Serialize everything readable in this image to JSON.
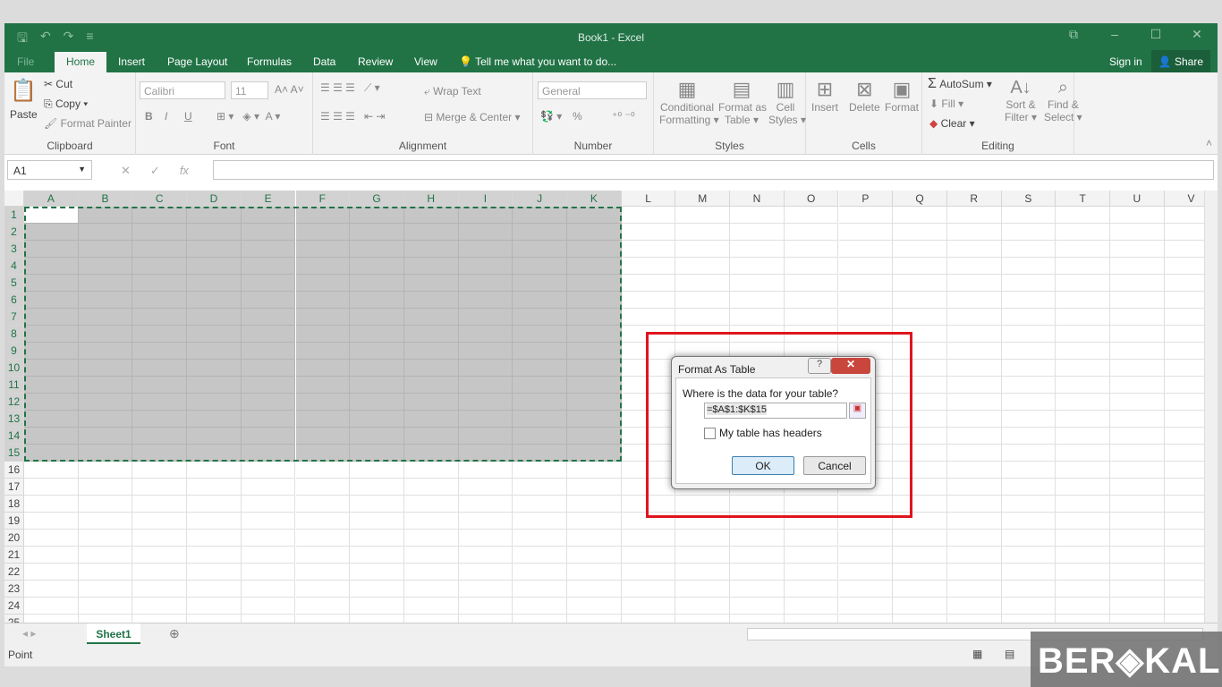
{
  "window": {
    "title": "Book1 - Excel",
    "controls": [
      "⧉",
      "–",
      "☐",
      "✕"
    ]
  },
  "qat": [
    "save-icon",
    "undo-icon",
    "redo-icon",
    "customize-icon"
  ],
  "tabs": [
    {
      "label": "File"
    },
    {
      "label": "Home"
    },
    {
      "label": "Insert"
    },
    {
      "label": "Page Layout"
    },
    {
      "label": "Formulas"
    },
    {
      "label": "Data"
    },
    {
      "label": "Review"
    },
    {
      "label": "View"
    }
  ],
  "tell_me": "Tell me what you want to do...",
  "sign_in": "Sign in",
  "share": "Share",
  "ribbon": {
    "clipboard": {
      "label": "Clipboard",
      "paste": "Paste",
      "cut": "Cut",
      "copy": "Copy",
      "format_painter": "Format Painter"
    },
    "font": {
      "label": "Font",
      "name": "Calibri",
      "size": "11",
      "bold": "B",
      "italic": "I",
      "underline": "U"
    },
    "alignment": {
      "label": "Alignment",
      "wrap": "Wrap Text",
      "merge": "Merge & Center"
    },
    "number": {
      "label": "Number",
      "format": "General",
      "percent": "%"
    },
    "styles": {
      "label": "Styles",
      "conditional": [
        "Conditional",
        "Formatting ▾"
      ],
      "format_table": [
        "Format as",
        "Table ▾"
      ],
      "cell_styles": [
        "Cell",
        "Styles ▾"
      ]
    },
    "cells": {
      "label": "Cells",
      "insert": "Insert",
      "delete": "Delete",
      "format": "Format"
    },
    "editing": {
      "label": "Editing",
      "autosum": "AutoSum",
      "fill": "Fill ▾",
      "clear": "Clear ▾",
      "sort": [
        "Sort &",
        "Filter ▾"
      ],
      "find": [
        "Find &",
        "Select ▾"
      ]
    }
  },
  "formula_bar": {
    "name_box": "A1",
    "value": ""
  },
  "grid": {
    "columns": [
      "A",
      "B",
      "C",
      "D",
      "E",
      "F",
      "G",
      "H",
      "I",
      "J",
      "K",
      "L",
      "M",
      "N",
      "O",
      "P",
      "Q",
      "R",
      "S",
      "T",
      "U",
      "V"
    ],
    "rows": 25,
    "selection": "A1:K15"
  },
  "sheets": [
    {
      "label": "Sheet1"
    }
  ],
  "status": "Point",
  "dialog": {
    "title": "Format As Table",
    "help": "?",
    "close": "✕",
    "question": "Where is the data for your table?",
    "range": "=$A$1:$K$15",
    "headers_label": "My table has headers",
    "headers_checked": false,
    "ok": "OK",
    "cancel": "Cancel"
  },
  "highlight_color": "#e0141e",
  "accent": "#217346",
  "watermark": "BERAKAL"
}
